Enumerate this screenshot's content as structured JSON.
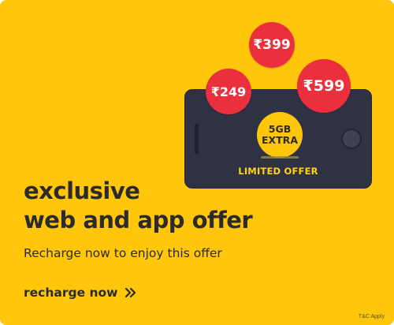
{
  "offer_card": {
    "headline_line1": "exclusive",
    "headline_line2": "web and app offer",
    "subtext": "Recharge now to enjoy this offer",
    "cta_label": "recharge now",
    "cta_icon": "double-chevron-right-icon",
    "terms": "T&C Apply"
  },
  "illustration": {
    "prices": [
      "₹399",
      "₹249",
      "₹599"
    ],
    "badge_line1": "5GB",
    "badge_line2": "EXTRA",
    "limited_offer": "LIMITED OFFER"
  },
  "colors": {
    "background": "#ffc60b",
    "price_bubble": "#ec2f3c",
    "phone": "#2f3243",
    "text": "#2b2b2b"
  }
}
